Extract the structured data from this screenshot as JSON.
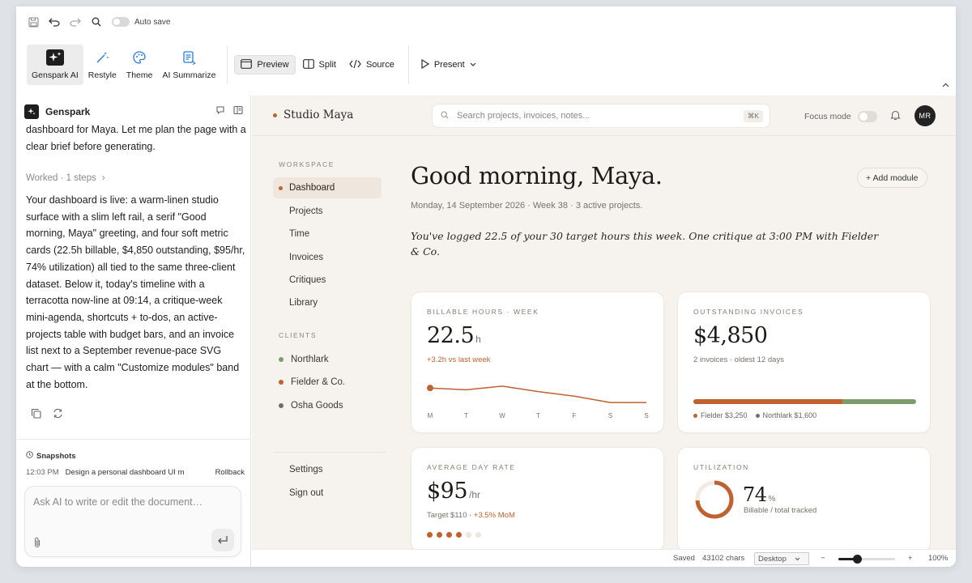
{
  "toolbar": {
    "autosave_label": "Auto save",
    "tools": [
      {
        "label": "Genspark AI",
        "icon": "sparkle-icon"
      },
      {
        "label": "Restyle",
        "icon": "magic-wand-icon"
      },
      {
        "label": "Theme",
        "icon": "palette-icon"
      },
      {
        "label": "AI Summarize",
        "icon": "summarize-icon"
      }
    ],
    "views": {
      "preview": "Preview",
      "split": "Split",
      "source": "Source"
    },
    "present": "Present"
  },
  "chat": {
    "title": "Genspark",
    "lead_text": "dashboard for Maya. Let me plan the page with a clear brief before generating.",
    "worked": "Worked · 1 steps",
    "reply": "Your dashboard is live: a warm-linen studio surface with a slim left rail, a serif \"Good morning, Maya\" greeting, and four soft metric cards (22.5h billable, $4,850 outstanding, $95/hr, 74% utilization) all tied to the same three-client dataset. Below it, today's timeline with a terracotta now-line at 09:14, a critique-week mini-agenda, shortcuts + to-dos, an active-projects table with budget bars, and an invoice list next to a September revenue-pace SVG chart — with a calm \"Customize modules\" band at the bottom.",
    "snapshots_title": "Snapshots",
    "snapshot": {
      "time": "12:03 PM",
      "desc": "Design a personal dashboard UI mockup",
      "action": "Rollback"
    },
    "input_placeholder": "Ask AI to write or edit the document…"
  },
  "app": {
    "brand": "Studio Maya",
    "search_placeholder": "Search projects, invoices, notes...",
    "search_kbd": "⌘K",
    "focus_mode": "Focus mode",
    "avatar": "MR",
    "nav": {
      "workspace_label": "WORKSPACE",
      "items": [
        "Dashboard",
        "Projects",
        "Time",
        "Invoices",
        "Critiques",
        "Library"
      ],
      "clients_label": "CLIENTS",
      "clients": [
        {
          "name": "Northlark",
          "color": "#7f9c6e"
        },
        {
          "name": "Fielder & Co.",
          "color": "#c0622f"
        },
        {
          "name": "Osha Goods",
          "color": "#6e6e72"
        }
      ],
      "settings": "Settings",
      "signout": "Sign out"
    },
    "greeting": "Good morning, Maya.",
    "date_line": "Monday, 14 September 2026 · Week 38 · 3 active projects.",
    "intro": "You've logged 22.5 of your 30 target hours this week. One critique at 3:00 PM with Fielder & Co.",
    "add_module": "+ Add module",
    "cards": {
      "billable": {
        "label": "BILLABLE HOURS · WEEK",
        "value": "22.5",
        "unit": "h",
        "sub": "+3.2h vs last week",
        "days": [
          "M",
          "T",
          "W",
          "T",
          "F",
          "S",
          "S"
        ],
        "hours": [
          5.4,
          5.0,
          5.8,
          4.6,
          3.6,
          2.2,
          2.2
        ]
      },
      "outstanding": {
        "label": "OUTSTANDING INVOICES",
        "value": "$4,850",
        "sub": "2 invoices · oldest 12 days",
        "legend": [
          {
            "label": "Fielder $3,250",
            "color": "#c0622f",
            "amount": 3250
          },
          {
            "label": "Northlark $1,600",
            "color": "#7f9c6e",
            "amount": 1600
          }
        ]
      },
      "rate": {
        "label": "AVERAGE DAY RATE",
        "value": "$95",
        "unit": "/hr",
        "target": "Target $110 ·",
        "delta": "+3.5% MoM",
        "rating": 4,
        "rating_max": 6
      },
      "util": {
        "label": "UTILIZATION",
        "value": "74",
        "unit": "%",
        "sub": "Billable / total tracked",
        "fraction": 0.74
      }
    }
  },
  "status": {
    "saved": "Saved",
    "chars": "43102 chars",
    "device": "Desktop",
    "zoom": "100%",
    "zoom_level": 0.33
  },
  "colors": {
    "accent": "#c0622f",
    "green": "#7f9c6e",
    "linen": "#f6f3ee"
  }
}
